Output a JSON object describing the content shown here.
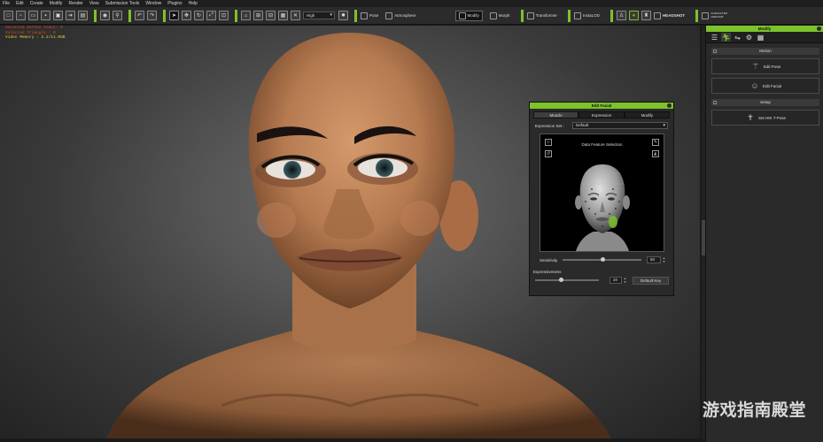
{
  "menu": [
    "File",
    "Edit",
    "Create",
    "Modify",
    "Render",
    "View",
    "Submission Tools",
    "Window",
    "Plugins",
    "Help"
  ],
  "stats": {
    "line1": "Selected Vertex Count: 0",
    "line2": "Selected Triangle : 0",
    "line3": "Video Memory : 2.2/11.0GB"
  },
  "toolbar": {
    "quality": "High",
    "pose": "Pose",
    "atmosphere": "Atmosphere",
    "modify": "Modify",
    "morph": "Morph",
    "transformer": "Transformer",
    "instalod": "InstaLOD",
    "headshot": "HEADSHOT",
    "character_creator": "CHARACTER CREATOR"
  },
  "right_panel": {
    "title": "Modify",
    "motion_section": "Motion",
    "edit_pose": "Edit Pose",
    "edit_facial": "Edit Facial",
    "setup_section": "Setup",
    "set_hik_tpose": "Set HIK T-Pose"
  },
  "facial_panel": {
    "title": "Edit Facial",
    "tabs": [
      "Muscle",
      "Expression",
      "Modify"
    ],
    "expression_set_label": "Expression Set :",
    "expression_set_value": "Default",
    "feature_caption": "Data Feature Selection",
    "sensitivity_label": "Sensitivity",
    "sensitivity_value": "50",
    "sensitivity_fraction": 0.5,
    "expressiveness_label": "Expressiveness",
    "expressiveness_value": "20",
    "expressiveness_fraction": 0.4,
    "default_key": "Default Key"
  },
  "watermark": "游戏指南殿堂",
  "colors": {
    "accent": "#7cc22b",
    "panel": "#2a2a2a",
    "skin": "#b88058"
  }
}
